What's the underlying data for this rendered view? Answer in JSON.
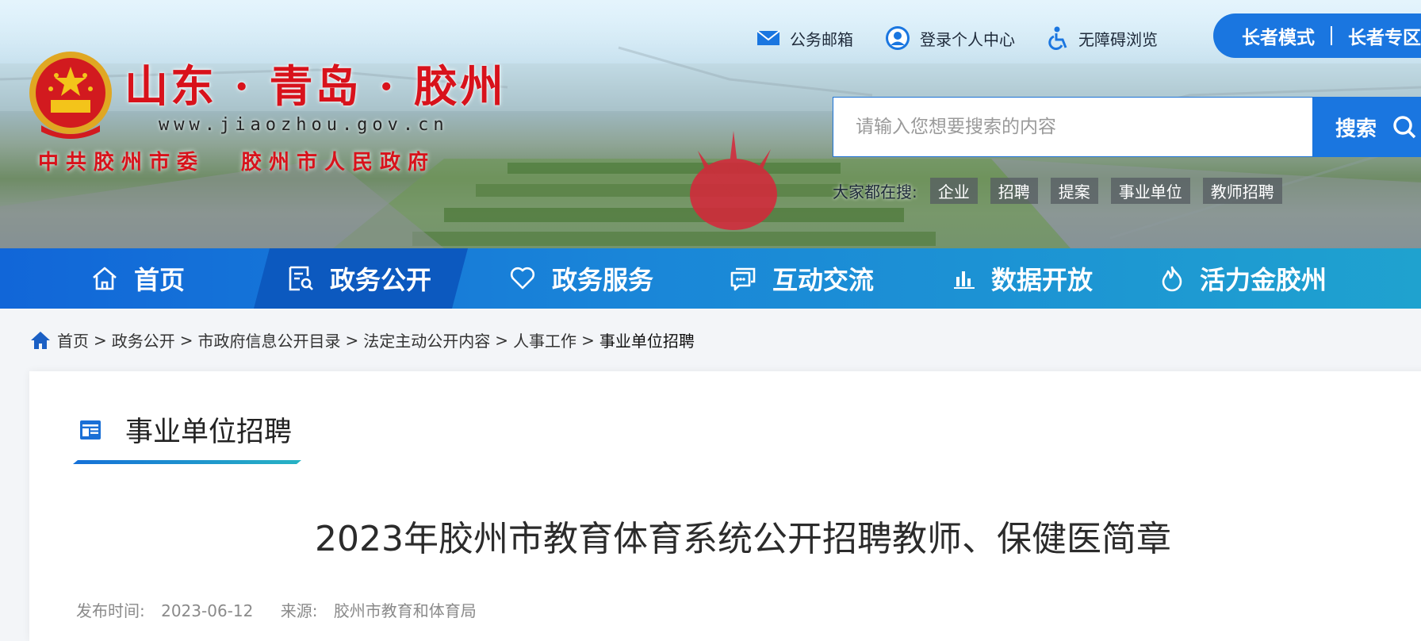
{
  "header": {
    "site_title": "山东 · 青岛 · 胶州",
    "site_url": "www.jiaozhou.gov.cn",
    "org_left": "中共胶州市委",
    "org_right": "胶州市人民政府",
    "top_links": [
      {
        "label": "公务邮箱",
        "icon": "mail-icon"
      },
      {
        "label": "登录个人中心",
        "icon": "user-icon"
      },
      {
        "label": "无障碍浏览",
        "icon": "accessibility-icon"
      }
    ],
    "elder_mode": "长者模式",
    "elder_zone": "长者专区"
  },
  "search": {
    "placeholder": "请输入您想要搜索的内容",
    "button": "搜索",
    "hot_label": "大家都在搜:",
    "hot_tags": [
      "企业",
      "招聘",
      "提案",
      "事业单位",
      "教师招聘"
    ]
  },
  "nav": {
    "items": [
      {
        "label": "首页",
        "icon": "home-icon"
      },
      {
        "label": "政务公开",
        "icon": "document-search-icon",
        "active": true
      },
      {
        "label": "政务服务",
        "icon": "heart-icon"
      },
      {
        "label": "互动交流",
        "icon": "chat-icon"
      },
      {
        "label": "数据开放",
        "icon": "bar-chart-icon"
      },
      {
        "label": "活力金胶州",
        "icon": "flame-icon"
      }
    ]
  },
  "breadcrumb": {
    "items": [
      "首页",
      "政务公开",
      "市政府信息公开目录",
      "法定主动公开内容",
      "人事工作",
      "事业单位招聘"
    ],
    "separator": ">"
  },
  "section": {
    "title": "事业单位招聘",
    "icon": "list-card-icon"
  },
  "article": {
    "title": "2023年胶州市教育体育系统公开招聘教师、保健医简章",
    "publish_label": "发布时间:",
    "publish_date": "2023-06-12",
    "source_label": "来源:",
    "source": "胶州市教育和体育局"
  },
  "colors": {
    "primary_blue": "#1a76e0",
    "title_red": "#d8121b",
    "nav_active": "#0c59bf"
  }
}
